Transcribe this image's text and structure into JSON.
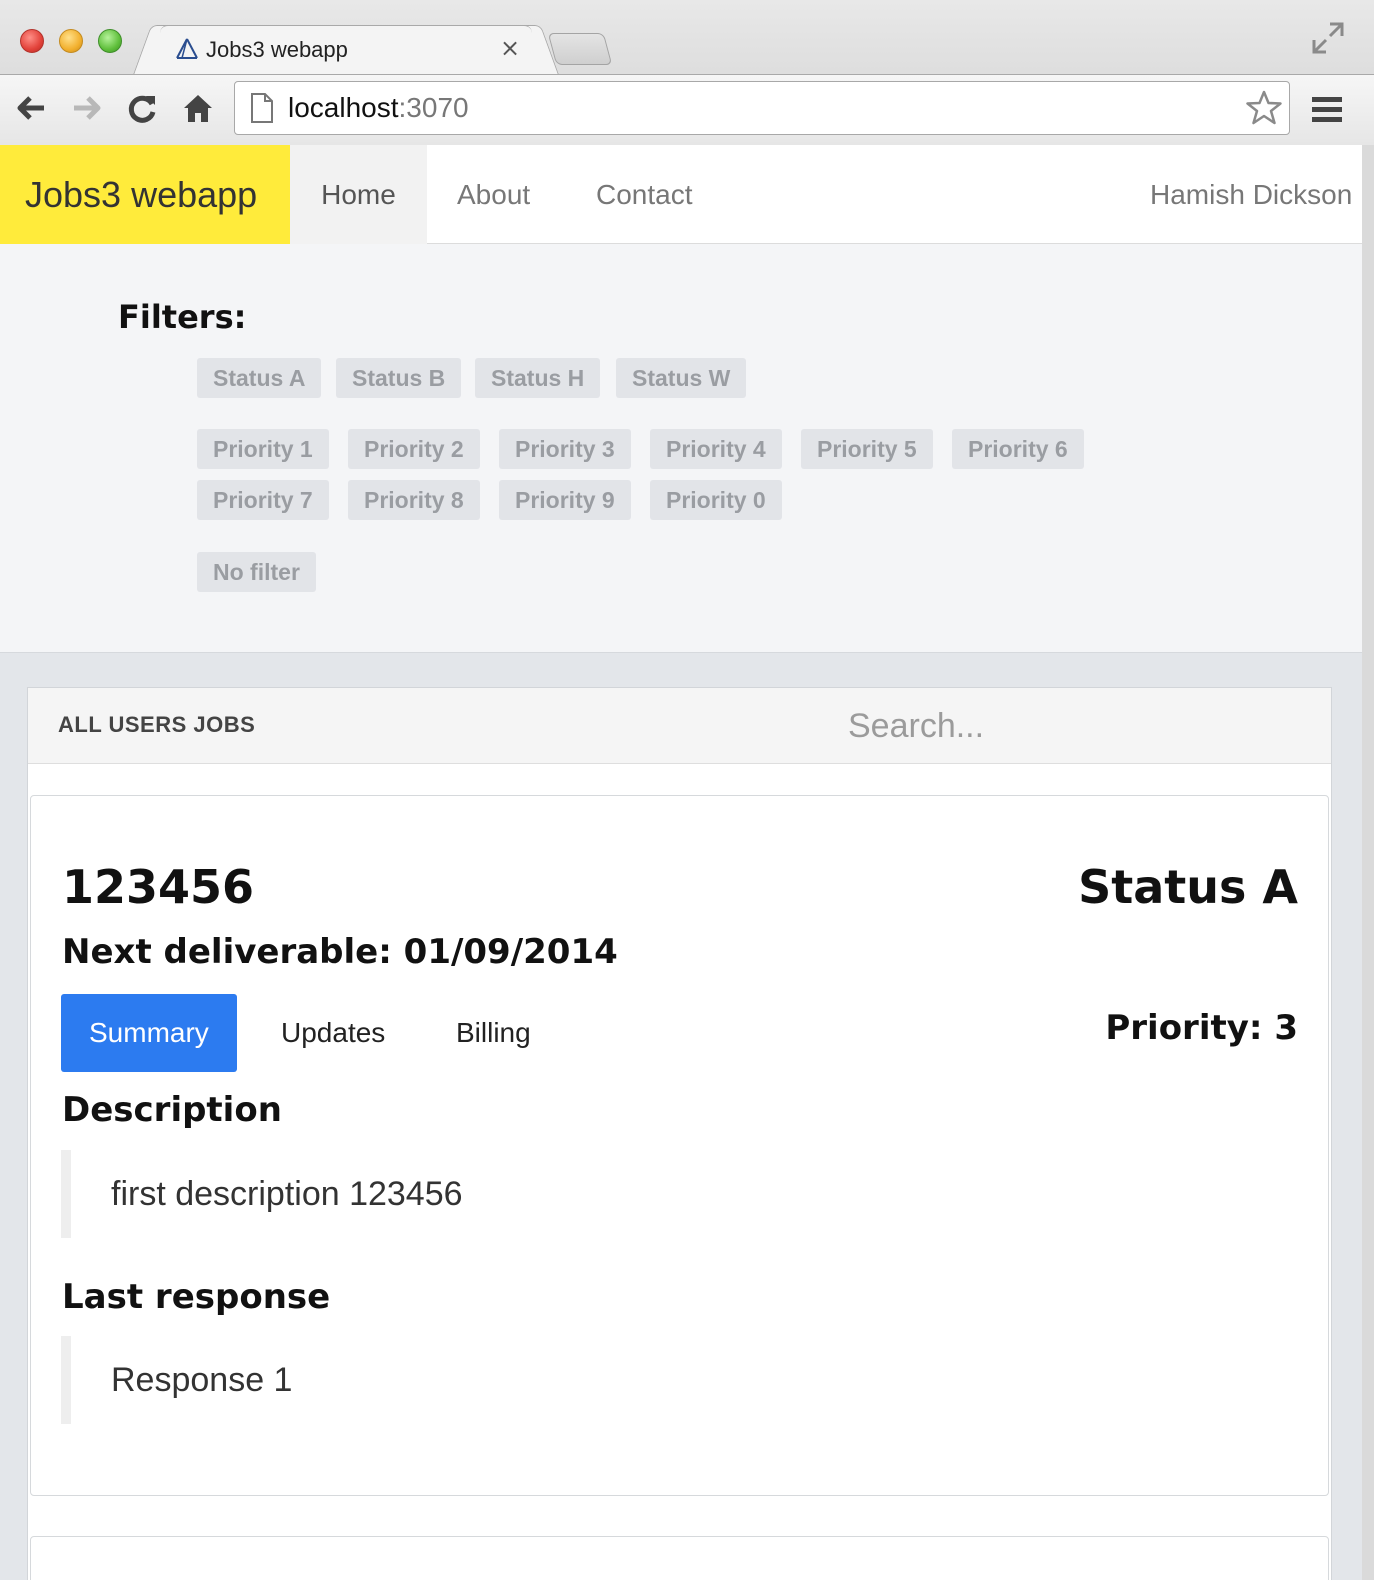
{
  "browser": {
    "tab_title": "Jobs3 webapp",
    "tab_close": "×",
    "url_host": "localhost",
    "url_port": ":3070"
  },
  "navbar": {
    "brand": "Jobs3 webapp",
    "links": [
      "Home",
      "About",
      "Contact"
    ],
    "active_link": "Home",
    "user": "Hamish Dickson",
    "brand_color": "#ffeb3b"
  },
  "filters": {
    "title": "Filters:",
    "status": [
      "Status A",
      "Status B",
      "Status H",
      "Status W"
    ],
    "priority": [
      "Priority 1",
      "Priority 2",
      "Priority 3",
      "Priority 4",
      "Priority 5",
      "Priority 6",
      "Priority 7",
      "Priority 8",
      "Priority 9",
      "Priority 0"
    ],
    "clear": "No filter"
  },
  "jobs_panel": {
    "title": "ALL USERS JOBS",
    "search_placeholder": "Search..."
  },
  "job": {
    "id": "123456",
    "status": "Status A",
    "next_deliverable": "Next deliverable: 01/09/2014",
    "tabs": [
      "Summary",
      "Updates",
      "Billing"
    ],
    "active_tab": "Summary",
    "active_tab_color": "#2c7bf0",
    "priority": "Priority: 3",
    "description_title": "Description",
    "description": "first description 123456",
    "last_response_title": "Last response",
    "last_response": "Response 1"
  }
}
